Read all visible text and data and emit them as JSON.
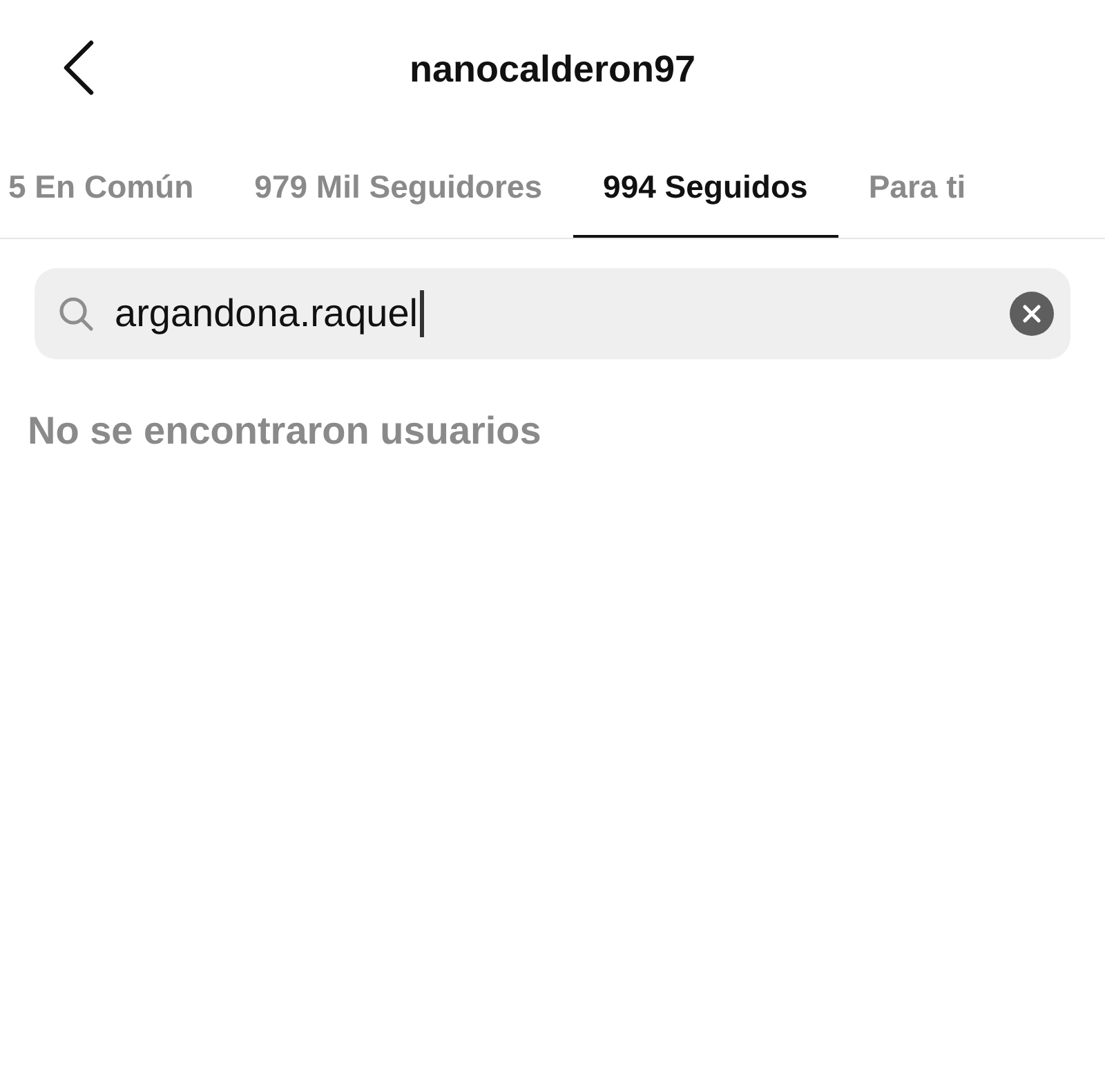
{
  "header": {
    "title": "nanocalderon97"
  },
  "tabs": [
    {
      "label": "5 En Común",
      "selected": false
    },
    {
      "label": "979 Mil Seguidores",
      "selected": false
    },
    {
      "label": "994 Seguidos",
      "selected": true
    },
    {
      "label": "Para ti",
      "selected": false
    }
  ],
  "search": {
    "value": "argandona.raquel"
  },
  "message": "No se encontraron usuarios"
}
